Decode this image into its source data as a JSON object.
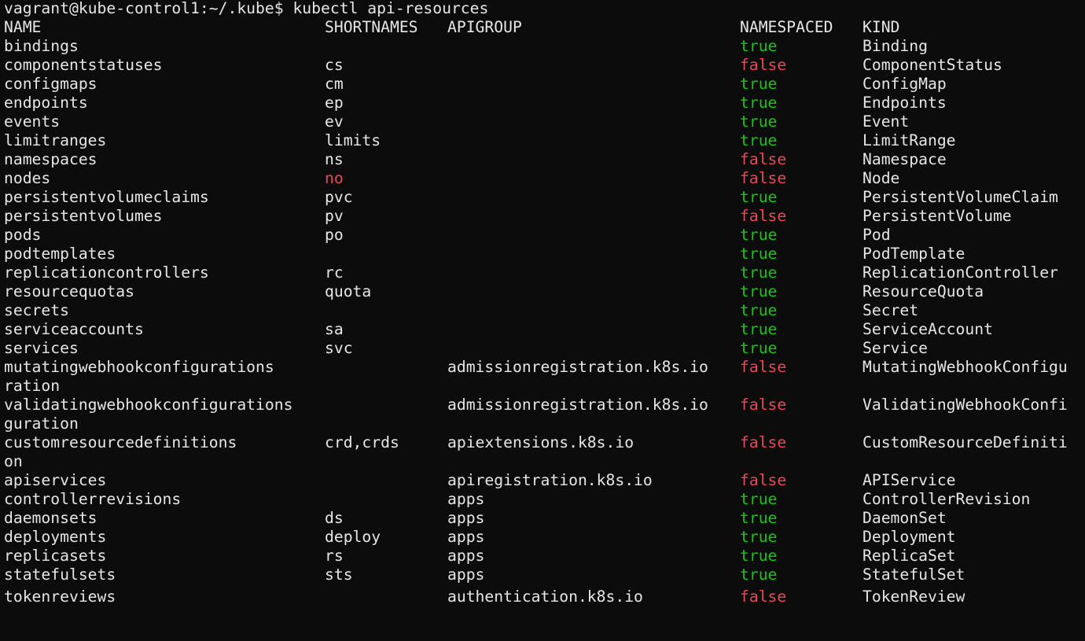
{
  "terminal": {
    "prompt": "vagrant@kube-control1:~/.kube$ kubectl api-resources",
    "colors": {
      "background": "#0c0c0c",
      "foreground": "#e6e6e6",
      "true": "#16c60c",
      "false": "#e74856"
    },
    "headers": {
      "name": "NAME",
      "shortnames": "SHORTNAMES",
      "apigroup": "APIGROUP",
      "namespaced": "NAMESPACED",
      "kind": "KIND"
    },
    "rows": [
      {
        "name": "bindings",
        "short": "",
        "group": "",
        "ns": "true",
        "kind": "Binding"
      },
      {
        "name": "componentstatuses",
        "short": "cs",
        "group": "",
        "ns": "false",
        "kind": "ComponentStatus"
      },
      {
        "name": "configmaps",
        "short": "cm",
        "group": "",
        "ns": "true",
        "kind": "ConfigMap"
      },
      {
        "name": "endpoints",
        "short": "ep",
        "group": "",
        "ns": "true",
        "kind": "Endpoints"
      },
      {
        "name": "events",
        "short": "ev",
        "group": "",
        "ns": "true",
        "kind": "Event"
      },
      {
        "name": "limitranges",
        "short": "limits",
        "group": "",
        "ns": "true",
        "kind": "LimitRange"
      },
      {
        "name": "namespaces",
        "short": "ns",
        "group": "",
        "ns": "false",
        "kind": "Namespace"
      },
      {
        "name": "nodes",
        "short": "no",
        "short_color": "red",
        "group": "",
        "ns": "false",
        "kind": "Node"
      },
      {
        "name": "persistentvolumeclaims",
        "short": "pvc",
        "group": "",
        "ns": "true",
        "kind": "PersistentVolumeClaim"
      },
      {
        "name": "persistentvolumes",
        "short": "pv",
        "group": "",
        "ns": "false",
        "kind": "PersistentVolume"
      },
      {
        "name": "pods",
        "short": "po",
        "group": "",
        "ns": "true",
        "kind": "Pod"
      },
      {
        "name": "podtemplates",
        "short": "",
        "group": "",
        "ns": "true",
        "kind": "PodTemplate"
      },
      {
        "name": "replicationcontrollers",
        "short": "rc",
        "group": "",
        "ns": "true",
        "kind": "ReplicationController"
      },
      {
        "name": "resourcequotas",
        "short": "quota",
        "group": "",
        "ns": "true",
        "kind": "ResourceQuota"
      },
      {
        "name": "secrets",
        "short": "",
        "group": "",
        "ns": "true",
        "kind": "Secret"
      },
      {
        "name": "serviceaccounts",
        "short": "sa",
        "group": "",
        "ns": "true",
        "kind": "ServiceAccount"
      },
      {
        "name": "services",
        "short": "svc",
        "group": "",
        "ns": "true",
        "kind": "Service"
      },
      {
        "name": "mutatingwebhookconfigurations",
        "short": "",
        "group": "admissionregistration.k8s.io",
        "ns": "false",
        "kind": "MutatingWebhookConfigu",
        "wrap": "ration"
      },
      {
        "name": "validatingwebhookconfigurations",
        "short": "",
        "group": "admissionregistration.k8s.io",
        "ns": "false",
        "kind": "ValidatingWebhookConfi",
        "wrap": "guration"
      },
      {
        "name": "customresourcedefinitions",
        "short": "crd,crds",
        "group": "apiextensions.k8s.io",
        "ns": "false",
        "kind": "CustomResourceDefiniti",
        "wrap": "on"
      },
      {
        "name": "apiservices",
        "short": "",
        "group": "apiregistration.k8s.io",
        "ns": "false",
        "kind": "APIService"
      },
      {
        "name": "controllerrevisions",
        "short": "",
        "group": "apps",
        "ns": "true",
        "kind": "ControllerRevision"
      },
      {
        "name": "daemonsets",
        "short": "ds",
        "group": "apps",
        "ns": "true",
        "kind": "DaemonSet"
      },
      {
        "name": "deployments",
        "short": "deploy",
        "group": "apps",
        "ns": "true",
        "kind": "Deployment"
      },
      {
        "name": "replicasets",
        "short": "rs",
        "group": "apps",
        "ns": "true",
        "kind": "ReplicaSet"
      },
      {
        "name": "statefulsets",
        "short": "sts",
        "group": "apps",
        "ns": "true",
        "kind": "StatefulSet"
      }
    ],
    "trailing_row": {
      "name": "tokenreviews",
      "short": "",
      "group": "authentication.k8s.io",
      "ns": "false",
      "kind": "TokenReview"
    }
  }
}
